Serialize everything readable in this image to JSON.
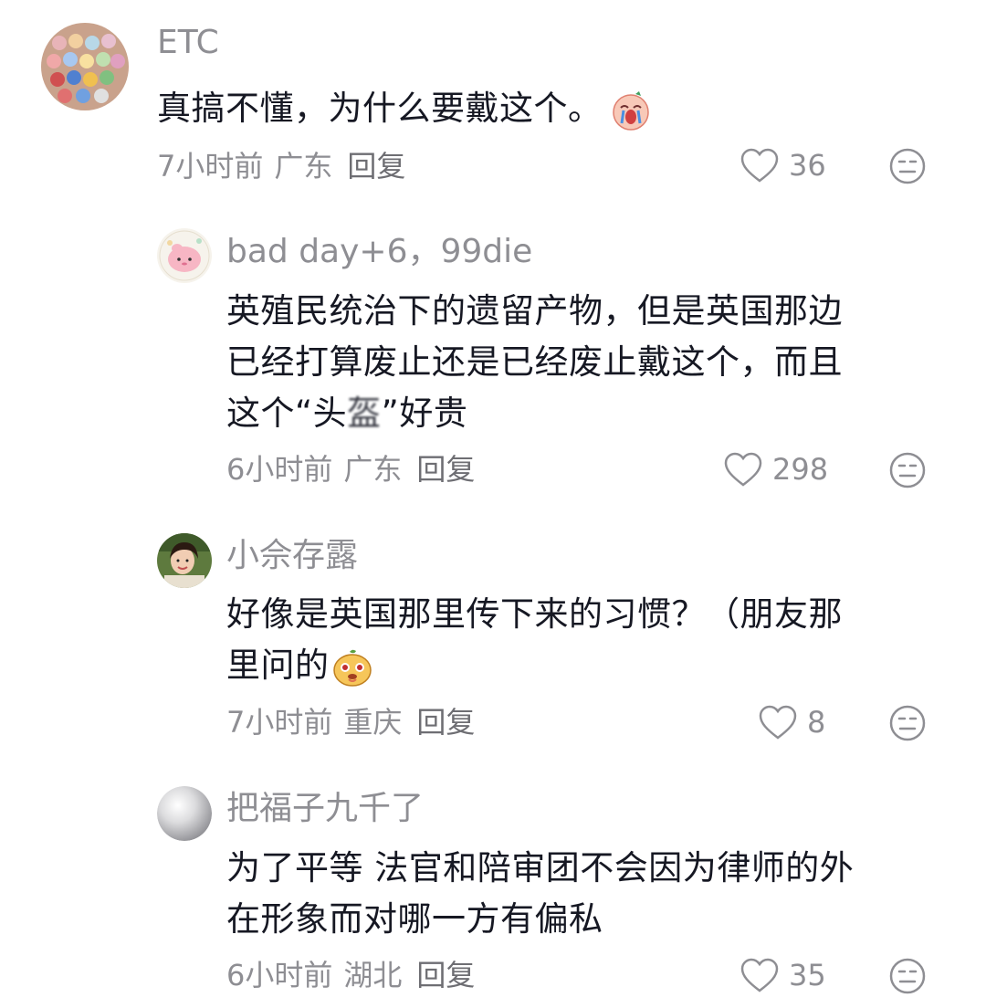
{
  "comments": [
    {
      "username": "ETC",
      "text_lines": [
        "真搞不懂，为什么要戴这个。"
      ],
      "emoji": "crying-face-emoji",
      "time": "7小时前",
      "location": "广东",
      "reply_label": "回复",
      "likes": "36"
    },
    {
      "username": "bad day+6，99die",
      "text_lines": [
        "英殖民统治下的遗留产物，但是英国那边",
        "已经打算废止还是已经废止戴这个，而且"
      ],
      "text_line3_a": "这个“头",
      "text_line3_blur": "盔",
      "text_line3_b": "”好贵",
      "time": "6小时前",
      "location": "广东",
      "reply_label": "回复",
      "likes": "298"
    },
    {
      "username": "小佘存露",
      "text_lines": [
        "好像是英国那里传下来的习惯？（朋友那",
        "里问的"
      ],
      "emoji": "cute-face-emoji",
      "time": "7小时前",
      "location": "重庆",
      "reply_label": "回复",
      "likes": "8"
    },
    {
      "username": "把福子九千了",
      "text_lines": [
        "为了平等 法官和陪审团不会因为律师的外",
        "在形象而对哪一方有偏私"
      ],
      "time": "6小时前",
      "location": "湖北",
      "reply_label": "回复",
      "likes": "35"
    }
  ],
  "icons": {
    "like": "heart-outline-icon",
    "dislike": "meh-face-icon"
  },
  "colors": {
    "text": "#161823",
    "muted": "#8e8e93"
  }
}
